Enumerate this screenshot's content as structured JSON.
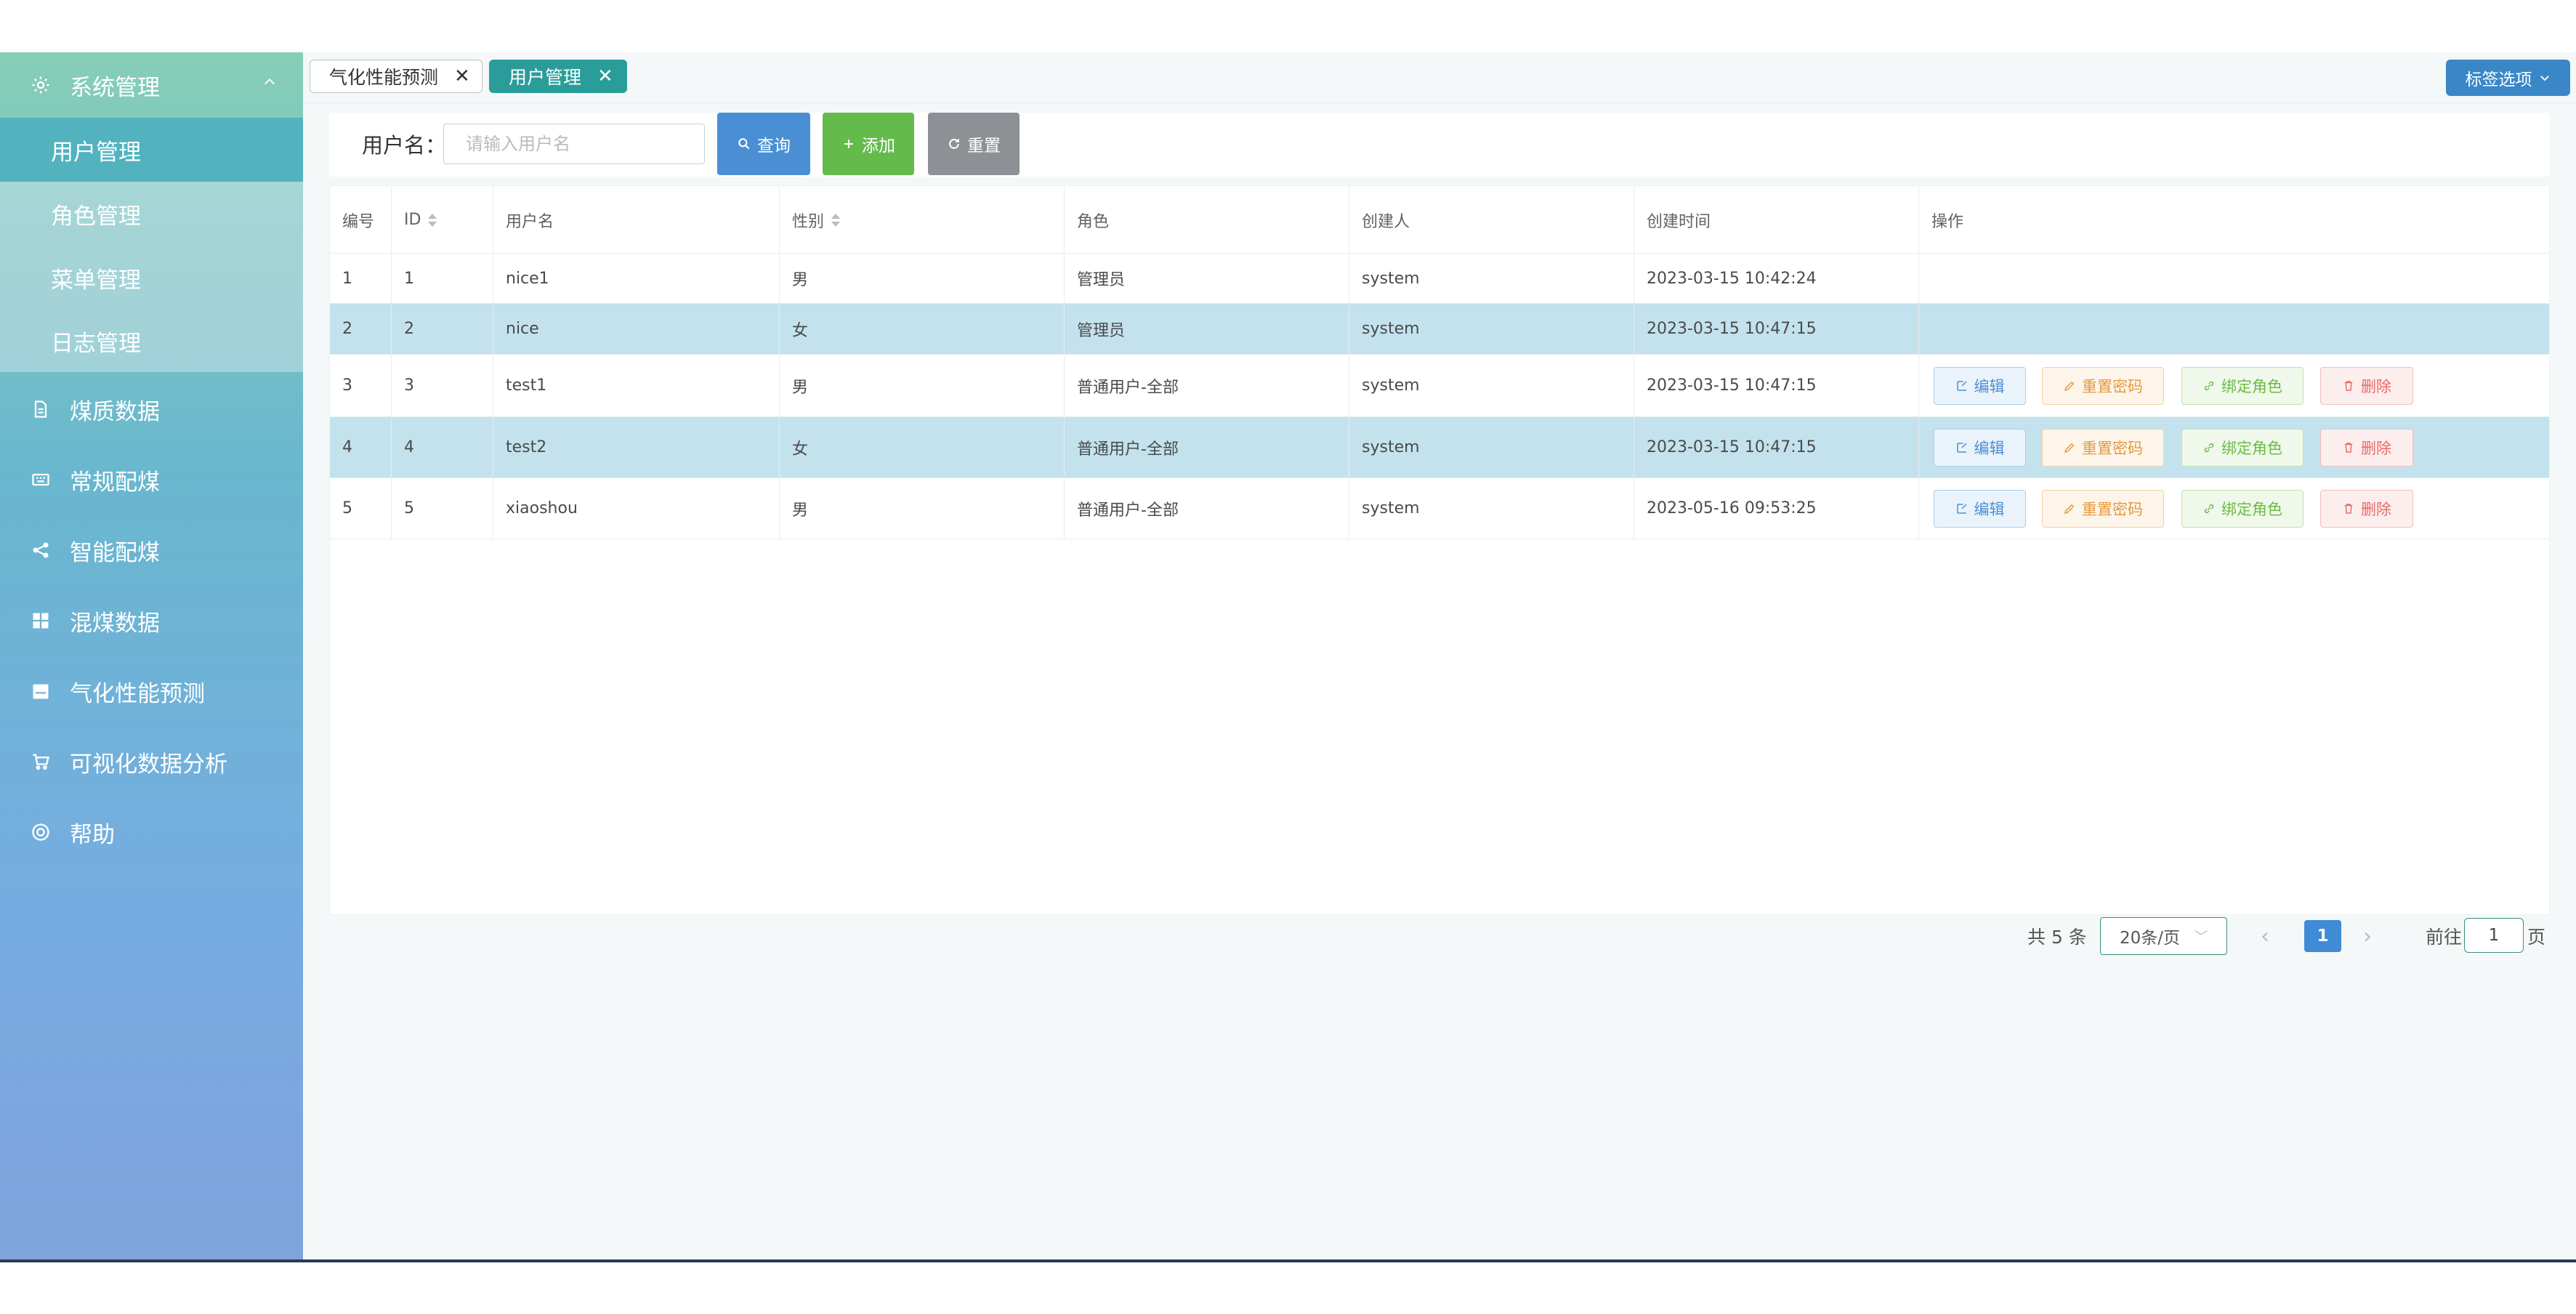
{
  "sidebar": {
    "group": {
      "label": "系统管理",
      "icon": "gear-icon",
      "expanded": true
    },
    "sub_items": [
      {
        "label": "用户管理",
        "active": true
      },
      {
        "label": "角色管理",
        "active": false
      },
      {
        "label": "菜单管理",
        "active": false
      },
      {
        "label": "日志管理",
        "active": false
      }
    ],
    "items": [
      {
        "label": "煤质数据",
        "icon": "document-icon"
      },
      {
        "label": "常规配煤",
        "icon": "keyboard-icon"
      },
      {
        "label": "智能配煤",
        "icon": "share-icon"
      },
      {
        "label": "混煤数据",
        "icon": "grid-icon"
      },
      {
        "label": "气化性能预测",
        "icon": "calendar-icon"
      },
      {
        "label": "可视化数据分析",
        "icon": "cart-icon"
      },
      {
        "label": "帮助",
        "icon": "help-circle-icon"
      }
    ]
  },
  "tabs": [
    {
      "label": "气化性能预测",
      "active": false
    },
    {
      "label": "用户管理",
      "active": true
    }
  ],
  "tab_options_label": "标签选项",
  "search": {
    "label": "用户名：",
    "placeholder": "请输入用户名",
    "query_label": "查询",
    "add_label": "添加",
    "reset_label": "重置"
  },
  "table": {
    "columns": [
      "编号",
      "ID",
      "用户名",
      "性别",
      "角色",
      "创建人",
      "创建时间",
      "操作"
    ],
    "rows": [
      {
        "no": "1",
        "id": "1",
        "username": "nice1",
        "gender": "男",
        "role": "管理员",
        "creator": "system",
        "created": "2023-03-15 10:42:24",
        "actions": false,
        "highlight": false
      },
      {
        "no": "2",
        "id": "2",
        "username": "nice",
        "gender": "女",
        "role": "管理员",
        "creator": "system",
        "created": "2023-03-15 10:47:15",
        "actions": false,
        "highlight": true
      },
      {
        "no": "3",
        "id": "3",
        "username": "test1",
        "gender": "男",
        "role": "普通用户-全部",
        "creator": "system",
        "created": "2023-03-15 10:47:15",
        "actions": true,
        "highlight": false
      },
      {
        "no": "4",
        "id": "4",
        "username": "test2",
        "gender": "女",
        "role": "普通用户-全部",
        "creator": "system",
        "created": "2023-03-15 10:47:15",
        "actions": true,
        "highlight": true
      },
      {
        "no": "5",
        "id": "5",
        "username": "xiaoshou",
        "gender": "男",
        "role": "普通用户-全部",
        "creator": "system",
        "created": "2023-05-16 09:53:25",
        "actions": true,
        "highlight": false
      }
    ],
    "action_labels": {
      "edit": "编辑",
      "reset_pwd": "重置密码",
      "bind_role": "绑定角色",
      "delete": "删除"
    }
  },
  "pagination": {
    "total": "共 5 条",
    "page_size": "20条/页",
    "current_page": "1",
    "goto": "前往",
    "goto_value": "1",
    "page_unit": "页"
  },
  "colors": {
    "accent_teal": "#2a9d9a",
    "primary_blue": "#4a8fd4",
    "success_green": "#64bb4c",
    "reset_gray": "#8d9196",
    "row_highlight": "#c3e2ee"
  }
}
